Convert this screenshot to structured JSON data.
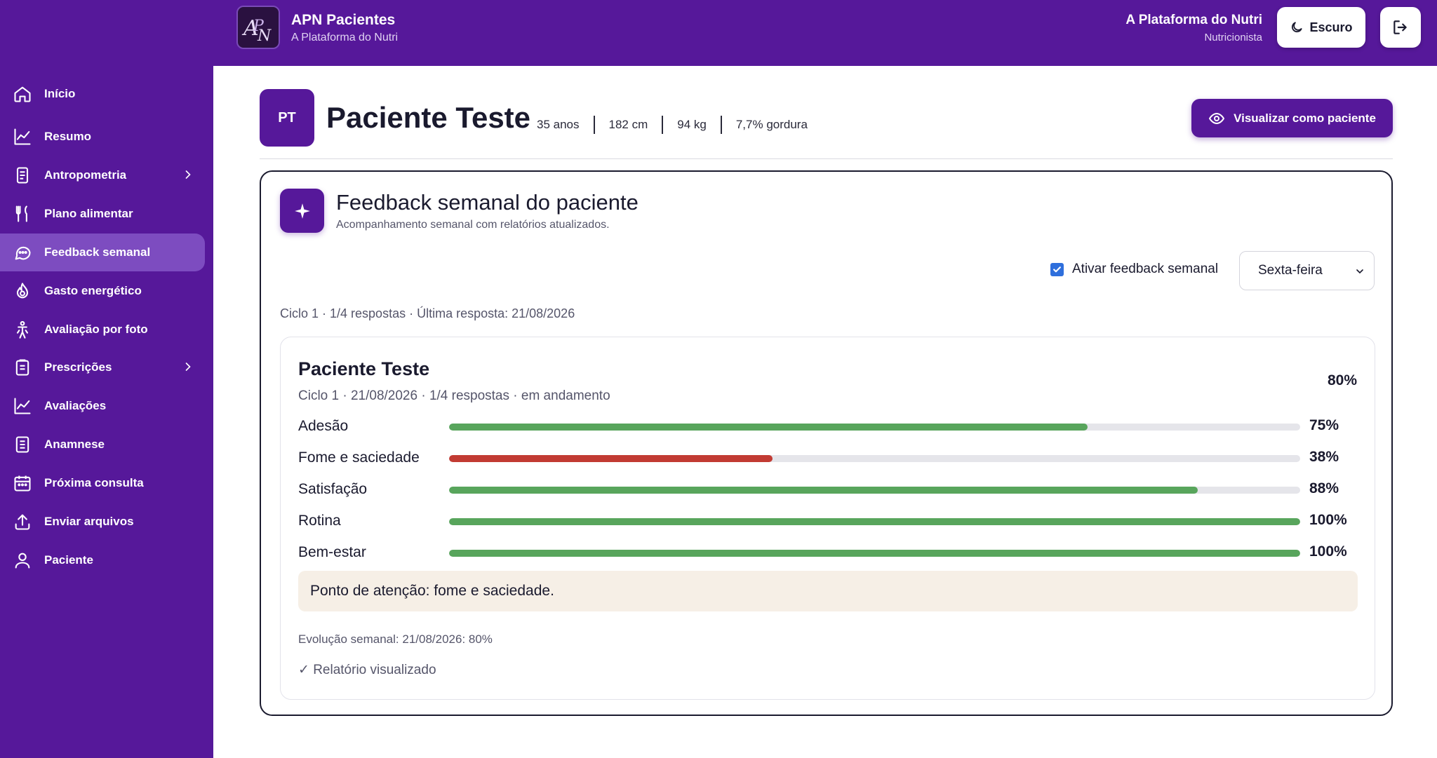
{
  "header": {
    "app_title": "APN Pacientes",
    "app_subtitle": "A Plataforma do Nutri",
    "user_name": "A Plataforma do Nutri",
    "user_role": "Nutricionista",
    "theme_label": "Escuro",
    "icons": {
      "theme": "moon-icon",
      "logout": "logout-icon"
    }
  },
  "sidebar": {
    "items": [
      {
        "label": "Início",
        "icon": "home-icon",
        "active": false
      },
      {
        "label": "Resumo",
        "icon": "chart-line-icon",
        "active": false
      },
      {
        "label": "Antropometria",
        "icon": "clipboard-icon",
        "active": false,
        "expandable": true
      },
      {
        "label": "Plano alimentar",
        "icon": "utensils-icon",
        "active": false
      },
      {
        "label": "Feedback semanal",
        "icon": "chat-bubble-icon",
        "active": true
      },
      {
        "label": "Gasto energético",
        "icon": "flame-icon",
        "active": false
      },
      {
        "label": "Avaliação por foto",
        "icon": "person-icon",
        "active": false
      },
      {
        "label": "Prescrições",
        "icon": "clipboard-icon",
        "active": false,
        "expandable": true
      },
      {
        "label": "Avaliações",
        "icon": "chart-line-icon",
        "active": false
      },
      {
        "label": "Anamnese",
        "icon": "document-icon",
        "active": false
      },
      {
        "label": "Próxima consulta",
        "icon": "calendar-icon",
        "active": false
      },
      {
        "label": "Enviar arquivos",
        "icon": "upload-icon",
        "active": false
      },
      {
        "label": "Paciente",
        "icon": "user-icon",
        "active": false
      }
    ]
  },
  "patient": {
    "initials": "PT",
    "name": "Paciente Teste",
    "age": "35 anos",
    "height": "182 cm",
    "weight": "94 kg",
    "body_fat": "7,7% gordura",
    "view_as_patient_label": "Visualizar como paciente"
  },
  "feedback": {
    "title": "Feedback semanal do paciente",
    "subtitle": "Acompanhamento semanal com relatórios atualizados.",
    "toggle_label": "Ativar feedback semanal",
    "toggle_checked": true,
    "day_selected": "Sexta-feira",
    "cycle_info": "Ciclo 1 · 1/4 respostas · Última resposta: 21/08/2026",
    "report": {
      "name": "Paciente Teste",
      "total": "80%",
      "meta": "Ciclo 1 · 21/08/2026 · 1/4 respostas · em andamento",
      "scores": [
        {
          "label": "Adesão",
          "percent": 75,
          "display": "75%",
          "color": "#58a55c"
        },
        {
          "label": "Fome e saciedade",
          "percent": 38,
          "display": "38%",
          "color": "#c23b33"
        },
        {
          "label": "Satisfação",
          "percent": 88,
          "display": "88%",
          "color": "#58a55c"
        },
        {
          "label": "Rotina",
          "percent": 100,
          "display": "100%",
          "color": "#58a55c"
        },
        {
          "label": "Bem-estar",
          "percent": 100,
          "display": "100%",
          "color": "#58a55c"
        }
      ],
      "attention": "Ponto de atenção: fome e saciedade.",
      "evolution": "Evolução semanal: 21/08/2026: 80%",
      "viewed": "✓ Relatório visualizado"
    }
  },
  "colors": {
    "brand": "#56189a",
    "sidebar_active": "#7d4cc0",
    "good": "#58a55c",
    "bad": "#c23b33",
    "attention_bg": "#f6efe6"
  }
}
